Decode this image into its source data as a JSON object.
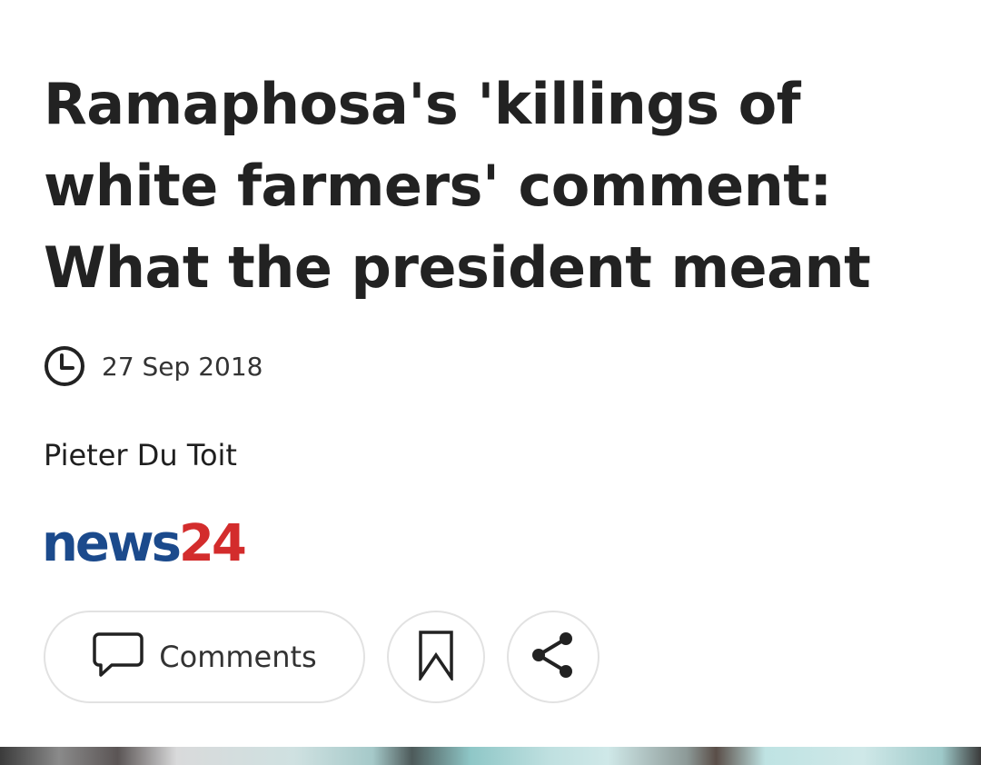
{
  "article": {
    "headline": "Ramaphosa's 'killings of white farmers' comment: What the president meant",
    "date": "27 Sep 2018",
    "author": "Pieter Du Toit"
  },
  "source_logo": {
    "news": "news",
    "number": "24",
    "colors": {
      "news": "#1b4a8c",
      "number": "#d32c2c"
    }
  },
  "actions": {
    "comments_label": "Comments",
    "icons": [
      "clock-icon",
      "comment-icon",
      "bookmark-icon",
      "share-icon"
    ]
  }
}
